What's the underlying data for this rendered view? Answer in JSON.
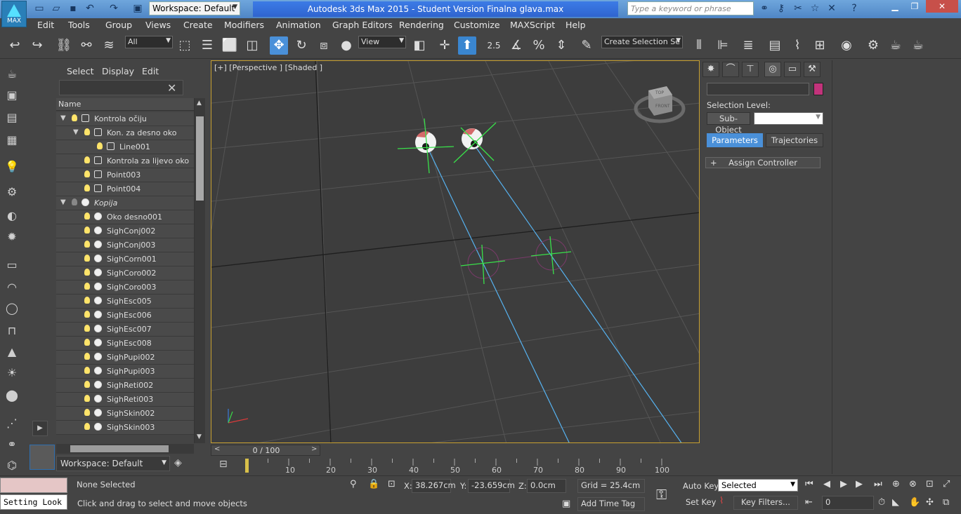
{
  "titlebar": {
    "app_logo_label": "MAX",
    "workspace": "Workspace: Default",
    "title": "Autodesk 3ds Max  2015   - Student Version    Finalna glava.max",
    "search_placeholder": "Type a keyword or phrase"
  },
  "menu": [
    "Edit",
    "Tools",
    "Group",
    "Views",
    "Create",
    "Modifiers",
    "Animation",
    "Graph Editors",
    "Rendering",
    "Customize",
    "MAXScript",
    "Help"
  ],
  "toolbar": {
    "selection_filter": "All",
    "ref_coord": "View",
    "snap_angle": "2.5",
    "named_selection": "Create Selection Se"
  },
  "explorer": {
    "tabs": [
      "Select",
      "Display",
      "Edit"
    ],
    "column_header": "Name",
    "rows": [
      {
        "label": "Kontrola očiju",
        "indent": 0,
        "expand": "▼",
        "bulb": "on",
        "icon": "group"
      },
      {
        "label": "Kon. za desno oko",
        "indent": 1,
        "expand": "▼",
        "bulb": "on",
        "icon": "group"
      },
      {
        "label": "Line001",
        "indent": 2,
        "expand": "",
        "bulb": "on",
        "icon": "shape"
      },
      {
        "label": "Kontrola za lijevo oko",
        "indent": 1,
        "expand": "",
        "bulb": "on",
        "icon": "helper"
      },
      {
        "label": "Point003",
        "indent": 1,
        "expand": "",
        "bulb": "on",
        "icon": "helper"
      },
      {
        "label": "Point004",
        "indent": 1,
        "expand": "",
        "bulb": "on",
        "icon": "helper"
      },
      {
        "label": "Kopija",
        "indent": 0,
        "expand": "▼",
        "bulb": "off",
        "icon": "sphere",
        "italic": true
      },
      {
        "label": "Oko desno001",
        "indent": 1,
        "expand": "",
        "bulb": "on",
        "icon": "sphere"
      },
      {
        "label": "SighConj002",
        "indent": 1,
        "expand": "",
        "bulb": "on",
        "icon": "sphere"
      },
      {
        "label": "SighConj003",
        "indent": 1,
        "expand": "",
        "bulb": "on",
        "icon": "sphere"
      },
      {
        "label": "SighCorn001",
        "indent": 1,
        "expand": "",
        "bulb": "on",
        "icon": "sphere"
      },
      {
        "label": "SighCoro002",
        "indent": 1,
        "expand": "",
        "bulb": "on",
        "icon": "sphere"
      },
      {
        "label": "SighCoro003",
        "indent": 1,
        "expand": "",
        "bulb": "on",
        "icon": "sphere"
      },
      {
        "label": "SighEsc005",
        "indent": 1,
        "expand": "",
        "bulb": "on",
        "icon": "sphere"
      },
      {
        "label": "SighEsc006",
        "indent": 1,
        "expand": "",
        "bulb": "on",
        "icon": "sphere"
      },
      {
        "label": "SighEsc007",
        "indent": 1,
        "expand": "",
        "bulb": "on",
        "icon": "sphere"
      },
      {
        "label": "SighEsc008",
        "indent": 1,
        "expand": "",
        "bulb": "on",
        "icon": "sphere"
      },
      {
        "label": "SighPupi002",
        "indent": 1,
        "expand": "",
        "bulb": "on",
        "icon": "sphere"
      },
      {
        "label": "SighPupi003",
        "indent": 1,
        "expand": "",
        "bulb": "on",
        "icon": "sphere"
      },
      {
        "label": "SighReti002",
        "indent": 1,
        "expand": "",
        "bulb": "on",
        "icon": "sphere"
      },
      {
        "label": "SighReti003",
        "indent": 1,
        "expand": "",
        "bulb": "on",
        "icon": "sphere"
      },
      {
        "label": "SighSkin002",
        "indent": 1,
        "expand": "",
        "bulb": "on",
        "icon": "sphere"
      },
      {
        "label": "SighSkin003",
        "indent": 1,
        "expand": "",
        "bulb": "on",
        "icon": "sphere"
      }
    ],
    "workspace": "Workspace: Default"
  },
  "viewport": {
    "label": "[+] [Perspective ] [Shaded ]",
    "viewcube_top": "TOP",
    "viewcube_front": "FRONT"
  },
  "timeline": {
    "slider": "0 / 100",
    "ticks": [
      "10",
      "20",
      "30",
      "40",
      "50",
      "60",
      "70",
      "80",
      "90",
      "100"
    ]
  },
  "command_panel": {
    "selection_level": "Selection Level:",
    "subobject": "Sub-Object",
    "parameters": "Parameters",
    "trajectories": "Trajectories",
    "assign_controller": "Assign Controller",
    "object_color": "#c2337b"
  },
  "status": {
    "listener_text": "Setting Look",
    "selection": "None Selected",
    "prompt": "Click and drag to select and move objects",
    "x_label": "X:",
    "x_value": "38.267cm",
    "y_label": "Y:",
    "y_value": "-23.659cm",
    "z_label": "Z:",
    "z_value": "0.0cm",
    "grid": "Grid = 25.4cm",
    "add_time_tag": "Add Time Tag",
    "auto_key": "Auto Key",
    "set_key": "Set Key",
    "key_mode": "Selected",
    "key_filters": "Key Filters...",
    "frame": "0"
  }
}
